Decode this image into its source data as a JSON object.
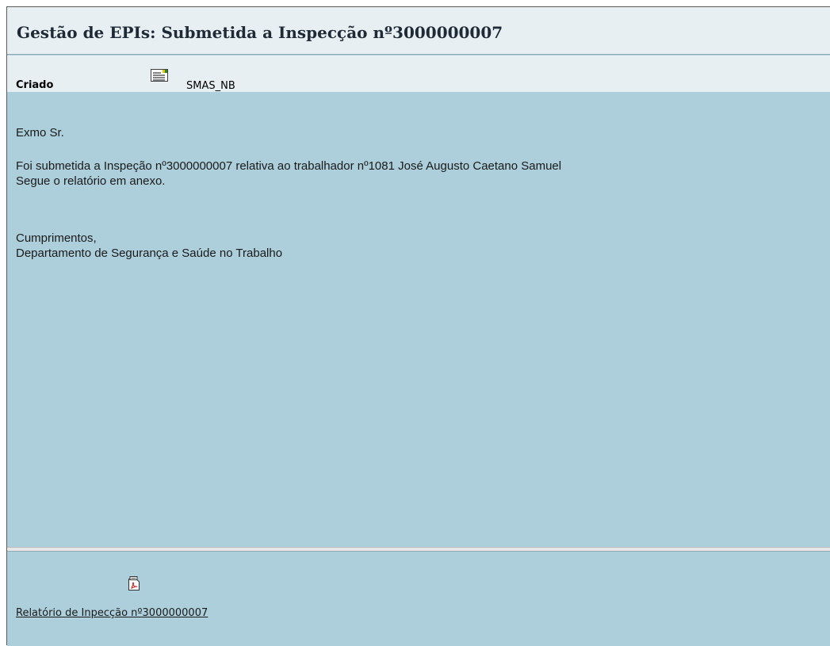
{
  "header": {
    "title": "Gestão de EPIs: Submetida a Inspecção nº3000000007"
  },
  "creator": {
    "label": "Criado",
    "icon": "document-icon",
    "value": "SMAS_NB"
  },
  "message": {
    "greeting": "Exmo Sr.",
    "line1": "Foi submetida a Inspeção nº3000000007 relativa ao trabalhador nº1081 José Augusto Caetano Samuel",
    "line2": "Segue o relatório em anexo.",
    "closing": "Cumprimentos,",
    "signature": "Departamento de Segurança e Saúde no Trabalho"
  },
  "attachment": {
    "icon": "pdf-icon",
    "label": "Relatório de Inpecção nº3000000007"
  },
  "colors": {
    "header_bg": "#e8eff2",
    "body_bg": "#adcfdb",
    "pdf_accent": "#cc2222"
  }
}
